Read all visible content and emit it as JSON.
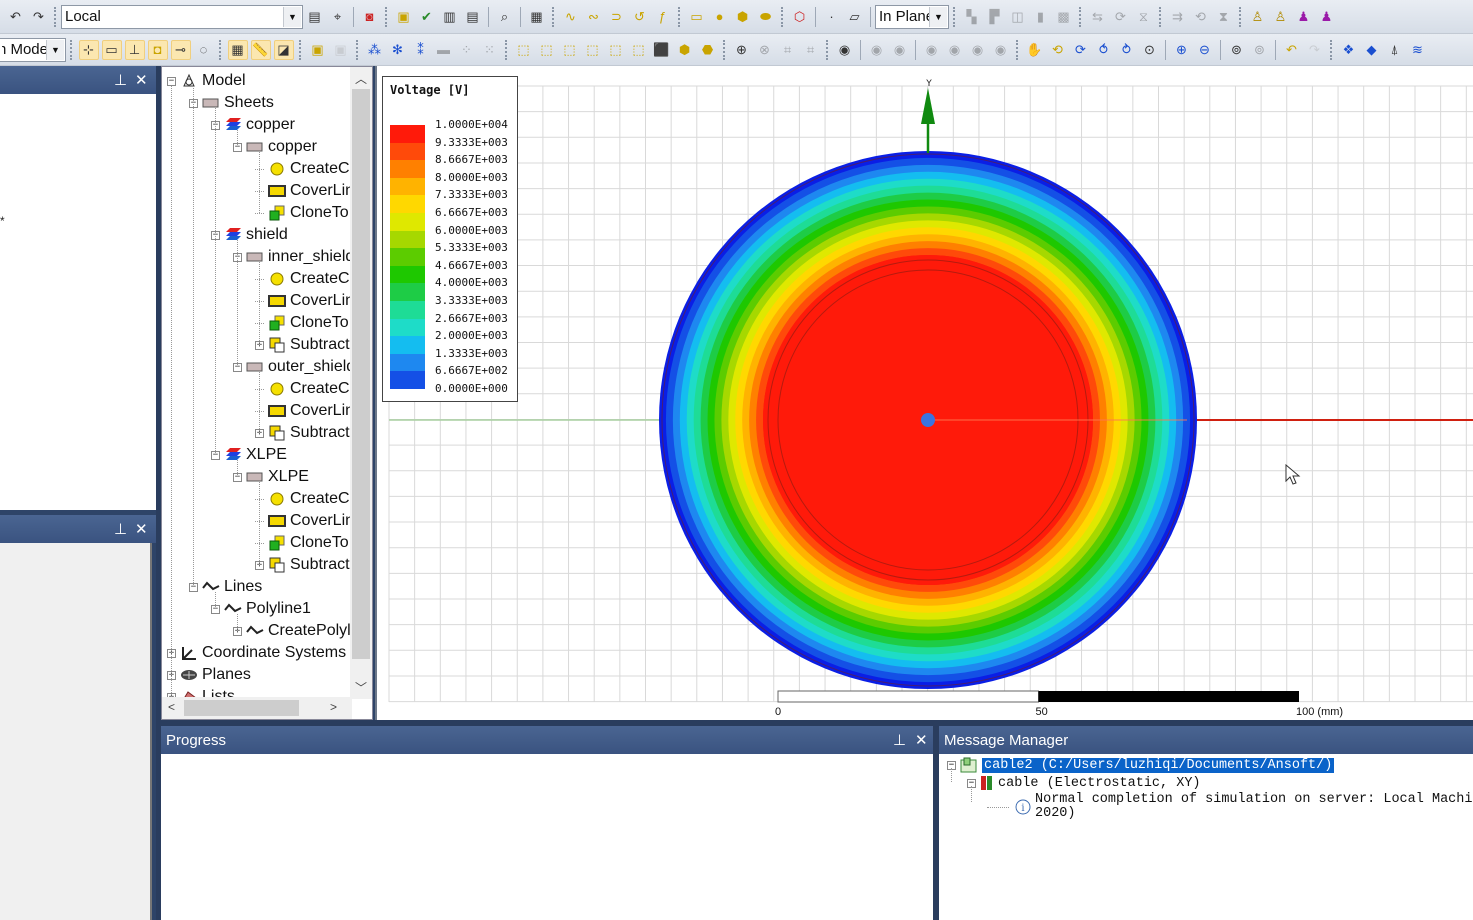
{
  "toolbar": {
    "coord_system": "Local",
    "drawing_plane": "In Plane",
    "mode": "In Mode",
    "row1_icons": [
      "undo-icon",
      "redo-icon",
      "|grip",
      "coord-combo",
      "insert-icon",
      "relative-cs-icon",
      "|sep",
      "validate-icon",
      "|grip",
      "project-icon",
      "check-icon",
      "analyze-icon",
      "report-icon",
      "|sep",
      "fit-icon",
      "|sep",
      "mesh-icon",
      "|grip",
      "line-icon",
      "spline-icon",
      "arc-icon",
      "center-arc-icon",
      "equation-curve-icon",
      "|grip",
      "rectangle-icon",
      "circle-icon",
      "polygon-icon",
      "ellipse-icon",
      "|grip",
      "region-icon",
      "|sep",
      "point-icon",
      "plane-icon",
      "|sep",
      "plane-combo",
      "|grip",
      "unite-icon",
      "subtract-icon",
      "intersect-icon",
      "imprint-icon",
      "split-icon",
      "|grip",
      "move-icon",
      "rotate-icon",
      "mirror-icon",
      "|grip",
      "dup-move-icon",
      "dup-rotate-icon",
      "dup-mirror-icon",
      "|grip",
      "excitation-icon",
      "boundary-icon",
      "assign-icon",
      "parameter-icon"
    ],
    "row2_icons": [
      "mode-combo",
      "|grip",
      "snap-grid-icon",
      "snap-vertex-icon",
      "snap-edge-midpoint-icon",
      "snap-face-center-icon",
      "snap-quadrant-icon",
      "snap-arc-center-icon",
      "|grip",
      "grid-icon",
      "ruler-icon",
      "paint-icon",
      "|grip",
      "box-icon",
      "dis-box-icon",
      "|grip",
      "net-icon",
      "tree-icon",
      "branch-icon",
      "dis-ruler-icon",
      "dis-scatter-icon",
      "dis-scatter2-icon",
      "|grip",
      "view-top-icon",
      "view-bottom-icon",
      "view-right-icon",
      "view-left-icon",
      "view-front-icon",
      "view-back-icon",
      "view-trimetric-icon",
      "view-iso-icon",
      "view-dimetric-icon",
      "|grip",
      "add-node-icon",
      "dis-del-node-icon",
      "dis-label-icon",
      "dis-label2-icon",
      "|grip",
      "visibility-icon",
      "|sep",
      "dis-eye1-icon",
      "dis-eye2-icon",
      "|sep",
      "dis-eye3-icon",
      "dis-eye4-icon",
      "dis-eye5-icon",
      "dis-eye6-icon",
      "|grip",
      "pan-icon",
      "rotate-view-icon",
      "orient-icon",
      "spin-icon",
      "dolly-icon",
      "zoom-icon",
      "|sep",
      "zoom-in-icon",
      "zoom-out-icon",
      "|sep",
      "fit-all-icon",
      "dis-fit-sel-icon",
      "|sep",
      "undo-view-icon",
      "dis-redo-view-icon",
      "|grip",
      "field-overlay-icon",
      "add-field-icon",
      "render-icon",
      "stack-icon"
    ]
  },
  "panels": {
    "progress_title": "Progress",
    "message_title": "Message Manager"
  },
  "tree": {
    "nodes": [
      {
        "label": "Model",
        "depth": 0,
        "exp": "-",
        "icon": "model"
      },
      {
        "label": "Sheets",
        "depth": 1,
        "exp": "-",
        "icon": "sheet"
      },
      {
        "label": "copper",
        "depth": 2,
        "exp": "-",
        "icon": "material"
      },
      {
        "label": "copper",
        "depth": 3,
        "exp": "-",
        "icon": "sheet"
      },
      {
        "label": "CreateCircle",
        "depth": 4,
        "exp": "",
        "icon": "circle"
      },
      {
        "label": "CoverLines",
        "depth": 4,
        "exp": "",
        "icon": "cover"
      },
      {
        "label": "CloneTo",
        "depth": 4,
        "exp": "",
        "icon": "clone"
      },
      {
        "label": "shield",
        "depth": 2,
        "exp": "-",
        "icon": "material"
      },
      {
        "label": "inner_shield",
        "depth": 3,
        "exp": "-",
        "icon": "sheet"
      },
      {
        "label": "CreateCircle",
        "depth": 4,
        "exp": "",
        "icon": "circle"
      },
      {
        "label": "CoverLines",
        "depth": 4,
        "exp": "",
        "icon": "cover"
      },
      {
        "label": "CloneTo",
        "depth": 4,
        "exp": "",
        "icon": "clone"
      },
      {
        "label": "Subtract",
        "depth": 4,
        "exp": "+",
        "icon": "subtract"
      },
      {
        "label": "outer_shield",
        "depth": 3,
        "exp": "-",
        "icon": "sheet"
      },
      {
        "label": "CreateCircle",
        "depth": 4,
        "exp": "",
        "icon": "circle"
      },
      {
        "label": "CoverLines",
        "depth": 4,
        "exp": "",
        "icon": "cover"
      },
      {
        "label": "Subtract",
        "depth": 4,
        "exp": "+",
        "icon": "subtract"
      },
      {
        "label": "XLPE",
        "depth": 2,
        "exp": "-",
        "icon": "material"
      },
      {
        "label": "XLPE",
        "depth": 3,
        "exp": "-",
        "icon": "sheet"
      },
      {
        "label": "CreateCircle",
        "depth": 4,
        "exp": "",
        "icon": "circle"
      },
      {
        "label": "CoverLines",
        "depth": 4,
        "exp": "",
        "icon": "cover"
      },
      {
        "label": "CloneTo",
        "depth": 4,
        "exp": "",
        "icon": "clone"
      },
      {
        "label": "Subtract",
        "depth": 4,
        "exp": "+",
        "icon": "subtract"
      },
      {
        "label": "Lines",
        "depth": 1,
        "exp": "-",
        "icon": "line"
      },
      {
        "label": "Polyline1",
        "depth": 2,
        "exp": "-",
        "icon": "line"
      },
      {
        "label": "CreatePolyline",
        "depth": 3,
        "exp": "+",
        "icon": "line"
      },
      {
        "label": "Coordinate Systems",
        "depth": 0,
        "exp": "+",
        "icon": "cs"
      },
      {
        "label": "Planes",
        "depth": 0,
        "exp": "+",
        "icon": "planes"
      },
      {
        "label": "Lists",
        "depth": 0,
        "exp": "+",
        "icon": "lists"
      }
    ]
  },
  "plot": {
    "legend_title": "Voltage [V]",
    "legend_labels": [
      "1.0000E+004",
      "9.3333E+003",
      "8.6667E+003",
      "8.0000E+003",
      "7.3333E+003",
      "6.6667E+003",
      "6.0000E+003",
      "5.3333E+003",
      "4.6667E+003",
      "4.0000E+003",
      "3.3333E+003",
      "2.6667E+003",
      "2.0000E+003",
      "1.3333E+003",
      "6.6667E+002",
      "0.0000E+000"
    ],
    "legend_colors": [
      "#ff1a0a",
      "#ff4a0a",
      "#ff8000",
      "#ffb300",
      "#ffd800",
      "#dfe800",
      "#a6d800",
      "#5ccc00",
      "#1ec800",
      "#1ecc46",
      "#1edc96",
      "#1edcc8",
      "#14bdf0",
      "#1e88f0",
      "#1450e6",
      "#0a1ee6"
    ],
    "axis_y_label": "Y",
    "scale_labels": [
      "0",
      "50",
      "100 (mm)"
    ],
    "scale_unit": "mm",
    "colors": {
      "x_axis": "#d02010",
      "y_axis": "#108a10",
      "grid": "#d9d9d9"
    }
  },
  "messages": [
    {
      "text": "cable2 (C:/Users/luzhiqi/Documents/Ansoft/)",
      "depth": 0,
      "selected": true,
      "icon": "project"
    },
    {
      "text": "cable (Electrostatic, XY)",
      "depth": 1,
      "selected": false,
      "icon": "design"
    },
    {
      "text": "Normal completion of simulation on server: Local Machine",
      "depth": 2,
      "selected": false,
      "icon": "info",
      "cont": "2020)"
    }
  ]
}
